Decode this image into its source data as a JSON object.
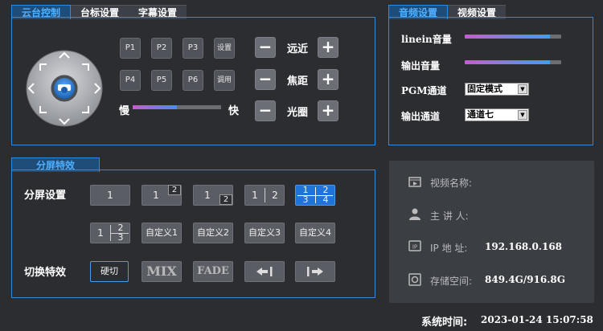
{
  "ptz": {
    "tabs": [
      "云台控制",
      "台标设置",
      "字幕设置"
    ],
    "presets": [
      "P1",
      "P2",
      "P3",
      "设置",
      "P4",
      "P5",
      "P6",
      "调用"
    ],
    "slow_label": "慢",
    "fast_label": "快",
    "speed_fraction": 0.5,
    "controls": [
      {
        "label": "远近",
        "minus": "−",
        "plus": "+"
      },
      {
        "label": "焦距",
        "minus": "−",
        "plus": "+"
      },
      {
        "label": "光圈",
        "minus": "−",
        "plus": "+"
      }
    ]
  },
  "audio": {
    "tabs": [
      "音频设置",
      "视频设置"
    ],
    "linein_label": "linein音量",
    "output_label": "输出音量",
    "linein_level": 0.88,
    "output_level": 0.88,
    "pgm_label": "PGM通道",
    "pgm_value": "固定模式",
    "out_channel_label": "输出通道",
    "out_channel_value": "通道七"
  },
  "split": {
    "tab": "分屏特效",
    "settings_label": "分屏设置",
    "effects_label": "切换特效",
    "custom": [
      "自定义1",
      "自定义2",
      "自定义3",
      "自定义4"
    ],
    "effects": [
      "硬切",
      "MIX",
      "FADE"
    ],
    "layout_digits": {
      "one": "1",
      "two": "2",
      "three": "3",
      "four": "4"
    }
  },
  "info": {
    "video_name_label": "视频名称:",
    "speaker_label": "主 讲 人:",
    "ip_label": "IP 地 址:",
    "ip_value": "192.168.0.168",
    "storage_label": "存储空间:",
    "storage_value": "849.4G/916.8G"
  },
  "status": {
    "time_label": "系统时间:",
    "time_value": "2023-01-24 15:07:58"
  },
  "colors": {
    "accent": "#2a8be0",
    "selected_layout": "#1e74d8"
  }
}
